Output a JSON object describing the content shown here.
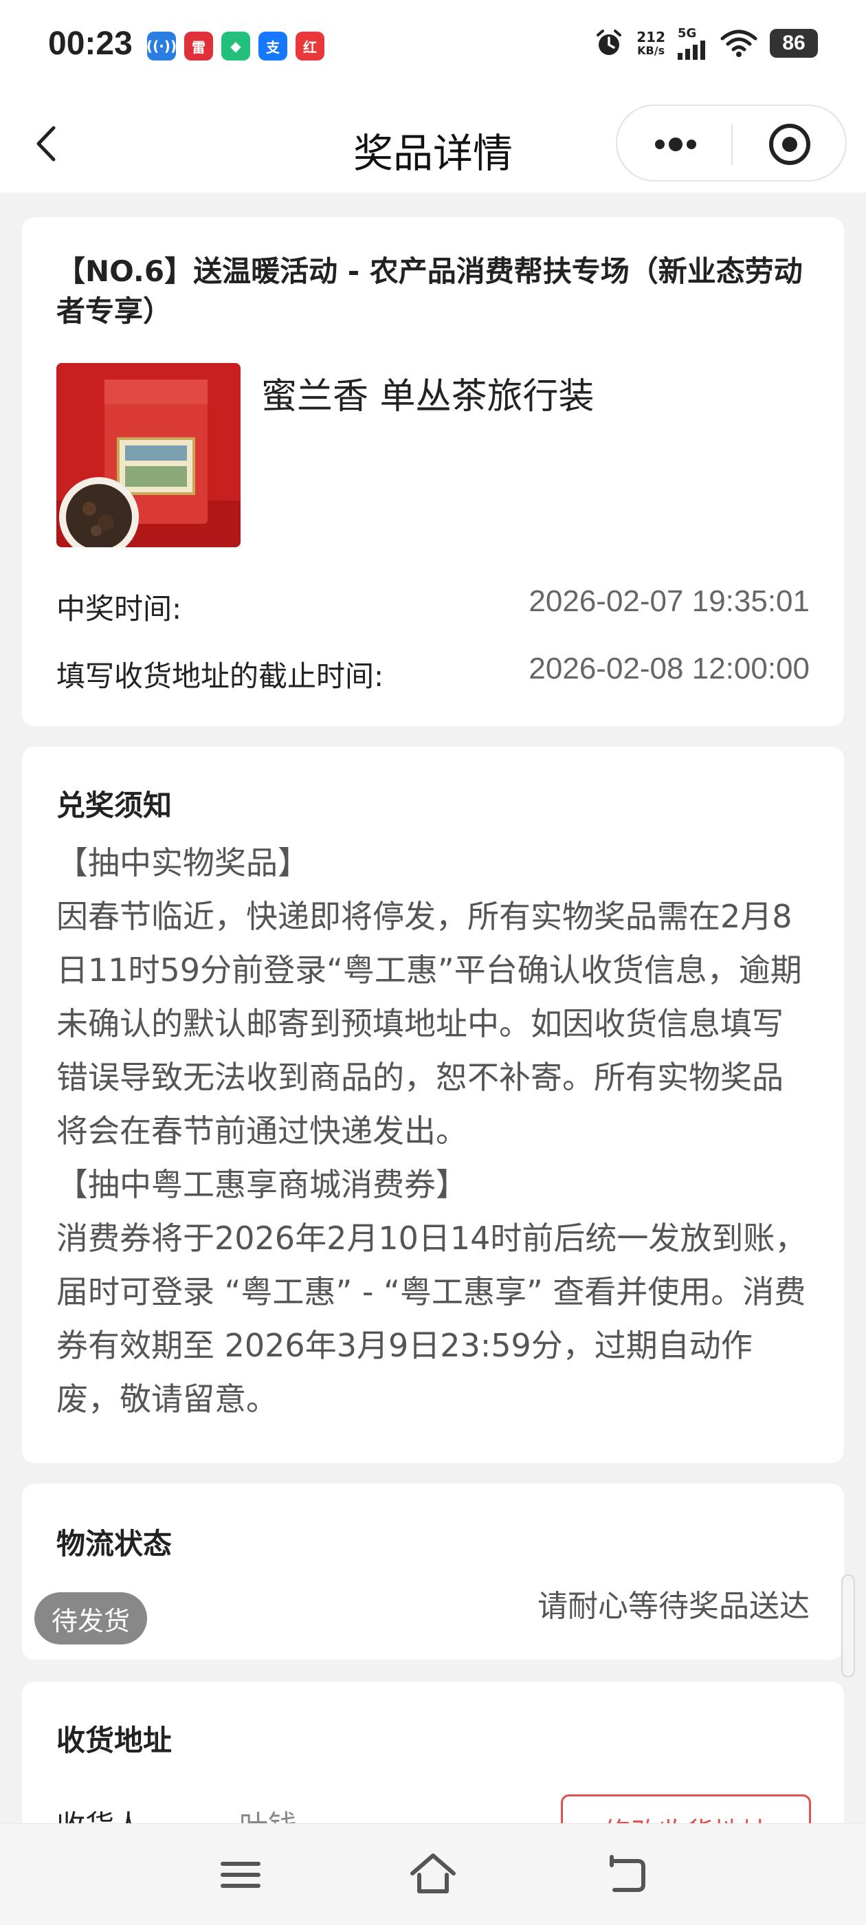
{
  "status_bar": {
    "time": "00:23",
    "notif_icons": [
      {
        "name": "radio-app-icon",
        "text": "((·))",
        "color": "#2a7de1"
      },
      {
        "name": "leida-app-icon",
        "text": "雷",
        "color": "#e0303a"
      },
      {
        "name": "shield-app-icon",
        "text": "◆",
        "color": "#22c07a"
      },
      {
        "name": "alipay-app-icon",
        "text": "支",
        "color": "#1677ff"
      },
      {
        "name": "shop-app-icon",
        "text": "红",
        "color": "#e8383a"
      }
    ],
    "net_speed_value": "212",
    "net_speed_unit": "KB/s",
    "network": "5G",
    "battery": "86"
  },
  "nav": {
    "title": "奖品详情"
  },
  "prize": {
    "activity_title": "【NO.6】送温暖活动 - 农产品消费帮扶专场（新业态劳动者专享）",
    "product_name": "蜜兰香 单丛茶旅行装",
    "product_image_icon": "tea-tin-image",
    "win_time_label": "中奖时间:",
    "win_time_value": "2026-02-07 19:35:01",
    "deadline_label": "填写收货地址的截止时间:",
    "deadline_value": "2026-02-08 12:00:00"
  },
  "notice": {
    "title": "兑奖须知",
    "paragraphs": [
      "【抽中实物奖品】",
      "因春节临近，快递即将停发，所有实物奖品需在2月8日11时59分前登录“粤工惠”平台确认收货信息，逾期未确认的默认邮寄到预填地址中。如因收货信息填写错误导致无法收到商品的，恕不补寄。所有实物奖品将会在春节前通过快递发出。",
      "【抽中粤工惠享商城消费券】",
      "消费券将于2026年2月10日14时前后统一发放到账，届时可登录 “粤工惠” - “粤工惠享” 查看并使用。消费券有效期至 2026年3月9日23:59分，过期自动作废，敬请留意。"
    ]
  },
  "logistics": {
    "title": "物流状态",
    "badge": "待发货",
    "message": "请耐心等待奖品送达"
  },
  "address": {
    "title": "收货地址",
    "recipient_label": "收货人",
    "recipient_value": "叶钱",
    "edit_button": "修改收货地址"
  }
}
